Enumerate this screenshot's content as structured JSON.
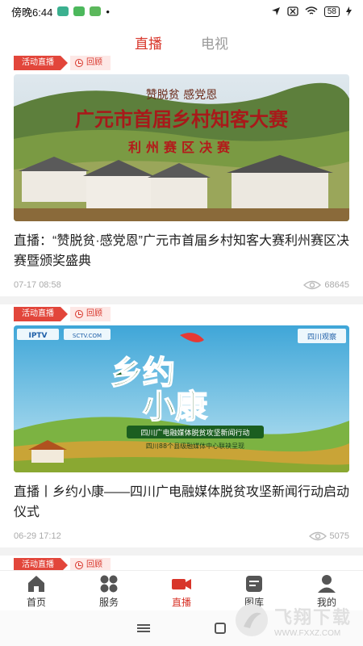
{
  "status_bar": {
    "time": "傍晚6:44",
    "dot": "•",
    "battery": "58",
    "icons": [
      "location-arrow-icon",
      "close-box-icon",
      "wifi-icon",
      "battery-icon",
      "charging-icon"
    ]
  },
  "top_tabs": [
    {
      "label": "直播",
      "active": true
    },
    {
      "label": "电视",
      "active": false
    }
  ],
  "colors": {
    "accent": "#d8352a",
    "tag_bg": "#e2463b",
    "review_bg": "#fde8e6"
  },
  "cards": [
    {
      "tag": "活动直播",
      "review": "回顾",
      "title": "直播：“赞脱贫·感党恩”广元市首届乡村知客大赛利州赛区决赛暨颁奖盛典",
      "date": "07-17 08:58",
      "views": "68645",
      "image": {
        "line1": "赞脱贫 感党恩",
        "line2": "广元市首届乡村知客大赛",
        "line3": "利州赛区决赛"
      }
    },
    {
      "tag": "活动直播",
      "review": "回顾",
      "title": "直播丨乡约小康——四川广电融媒体脱贫攻坚新闻行动启动仪式",
      "date": "06-29 17:12",
      "views": "5075",
      "image": {
        "logo1": "IPTV",
        "logo2": "SCTV.COM",
        "logo3": "四川观察",
        "main": "乡约",
        "main2": "小康",
        "banner": "四川广电融媒体脱贫攻坚新闻行动",
        "sub": "四川88个县级融媒体中心联袂呈现"
      }
    },
    {
      "tag": "活动直播",
      "review": "回顾"
    }
  ],
  "bottom_nav": [
    {
      "label": "首页",
      "icon": "home-icon",
      "active": false
    },
    {
      "label": "服务",
      "icon": "grid-icon",
      "active": false
    },
    {
      "label": "直播",
      "icon": "video-camera-icon",
      "active": true
    },
    {
      "label": "图库",
      "icon": "gallery-icon",
      "active": false
    },
    {
      "label": "我的",
      "icon": "user-icon",
      "active": false
    }
  ],
  "watermark": {
    "main": "飞翔下载",
    "sub": "WWW.FXXZ.COM"
  }
}
